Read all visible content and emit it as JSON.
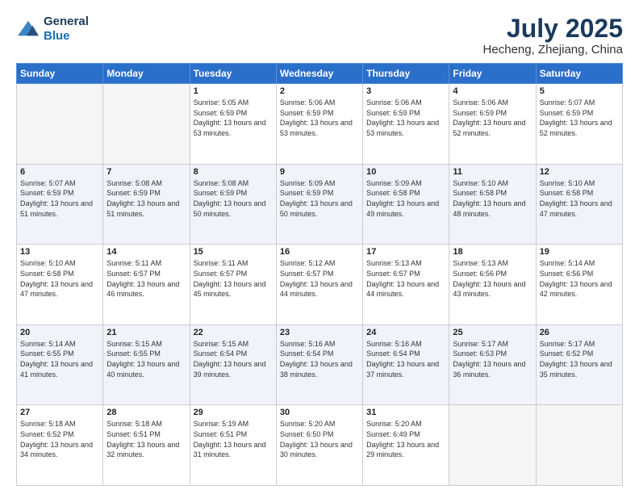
{
  "header": {
    "logo_line1": "General",
    "logo_line2": "Blue",
    "title": "July 2025",
    "subtitle": "Hecheng, Zhejiang, China"
  },
  "weekdays": [
    "Sunday",
    "Monday",
    "Tuesday",
    "Wednesday",
    "Thursday",
    "Friday",
    "Saturday"
  ],
  "weeks": [
    [
      {
        "day": "",
        "empty": true
      },
      {
        "day": "",
        "empty": true
      },
      {
        "day": "1",
        "sunrise": "5:05 AM",
        "sunset": "6:59 PM",
        "daylight": "13 hours and 53 minutes."
      },
      {
        "day": "2",
        "sunrise": "5:06 AM",
        "sunset": "6:59 PM",
        "daylight": "13 hours and 53 minutes."
      },
      {
        "day": "3",
        "sunrise": "5:06 AM",
        "sunset": "6:59 PM",
        "daylight": "13 hours and 53 minutes."
      },
      {
        "day": "4",
        "sunrise": "5:06 AM",
        "sunset": "6:59 PM",
        "daylight": "13 hours and 52 minutes."
      },
      {
        "day": "5",
        "sunrise": "5:07 AM",
        "sunset": "6:59 PM",
        "daylight": "13 hours and 52 minutes."
      }
    ],
    [
      {
        "day": "6",
        "sunrise": "5:07 AM",
        "sunset": "6:59 PM",
        "daylight": "13 hours and 51 minutes."
      },
      {
        "day": "7",
        "sunrise": "5:08 AM",
        "sunset": "6:59 PM",
        "daylight": "13 hours and 51 minutes."
      },
      {
        "day": "8",
        "sunrise": "5:08 AM",
        "sunset": "6:59 PM",
        "daylight": "13 hours and 50 minutes."
      },
      {
        "day": "9",
        "sunrise": "5:09 AM",
        "sunset": "6:59 PM",
        "daylight": "13 hours and 50 minutes."
      },
      {
        "day": "10",
        "sunrise": "5:09 AM",
        "sunset": "6:58 PM",
        "daylight": "13 hours and 49 minutes."
      },
      {
        "day": "11",
        "sunrise": "5:10 AM",
        "sunset": "6:58 PM",
        "daylight": "13 hours and 48 minutes."
      },
      {
        "day": "12",
        "sunrise": "5:10 AM",
        "sunset": "6:58 PM",
        "daylight": "13 hours and 47 minutes."
      }
    ],
    [
      {
        "day": "13",
        "sunrise": "5:10 AM",
        "sunset": "6:58 PM",
        "daylight": "13 hours and 47 minutes."
      },
      {
        "day": "14",
        "sunrise": "5:11 AM",
        "sunset": "6:57 PM",
        "daylight": "13 hours and 46 minutes."
      },
      {
        "day": "15",
        "sunrise": "5:11 AM",
        "sunset": "6:57 PM",
        "daylight": "13 hours and 45 minutes."
      },
      {
        "day": "16",
        "sunrise": "5:12 AM",
        "sunset": "6:57 PM",
        "daylight": "13 hours and 44 minutes."
      },
      {
        "day": "17",
        "sunrise": "5:13 AM",
        "sunset": "6:57 PM",
        "daylight": "13 hours and 44 minutes."
      },
      {
        "day": "18",
        "sunrise": "5:13 AM",
        "sunset": "6:56 PM",
        "daylight": "13 hours and 43 minutes."
      },
      {
        "day": "19",
        "sunrise": "5:14 AM",
        "sunset": "6:56 PM",
        "daylight": "13 hours and 42 minutes."
      }
    ],
    [
      {
        "day": "20",
        "sunrise": "5:14 AM",
        "sunset": "6:55 PM",
        "daylight": "13 hours and 41 minutes."
      },
      {
        "day": "21",
        "sunrise": "5:15 AM",
        "sunset": "6:55 PM",
        "daylight": "13 hours and 40 minutes."
      },
      {
        "day": "22",
        "sunrise": "5:15 AM",
        "sunset": "6:54 PM",
        "daylight": "13 hours and 39 minutes."
      },
      {
        "day": "23",
        "sunrise": "5:16 AM",
        "sunset": "6:54 PM",
        "daylight": "13 hours and 38 minutes."
      },
      {
        "day": "24",
        "sunrise": "5:16 AM",
        "sunset": "6:54 PM",
        "daylight": "13 hours and 37 minutes."
      },
      {
        "day": "25",
        "sunrise": "5:17 AM",
        "sunset": "6:53 PM",
        "daylight": "13 hours and 36 minutes."
      },
      {
        "day": "26",
        "sunrise": "5:17 AM",
        "sunset": "6:52 PM",
        "daylight": "13 hours and 35 minutes."
      }
    ],
    [
      {
        "day": "27",
        "sunrise": "5:18 AM",
        "sunset": "6:52 PM",
        "daylight": "13 hours and 34 minutes."
      },
      {
        "day": "28",
        "sunrise": "5:18 AM",
        "sunset": "6:51 PM",
        "daylight": "13 hours and 32 minutes."
      },
      {
        "day": "29",
        "sunrise": "5:19 AM",
        "sunset": "6:51 PM",
        "daylight": "13 hours and 31 minutes."
      },
      {
        "day": "30",
        "sunrise": "5:20 AM",
        "sunset": "6:50 PM",
        "daylight": "13 hours and 30 minutes."
      },
      {
        "day": "31",
        "sunrise": "5:20 AM",
        "sunset": "6:49 PM",
        "daylight": "13 hours and 29 minutes."
      },
      {
        "day": "",
        "empty": true
      },
      {
        "day": "",
        "empty": true
      }
    ]
  ]
}
